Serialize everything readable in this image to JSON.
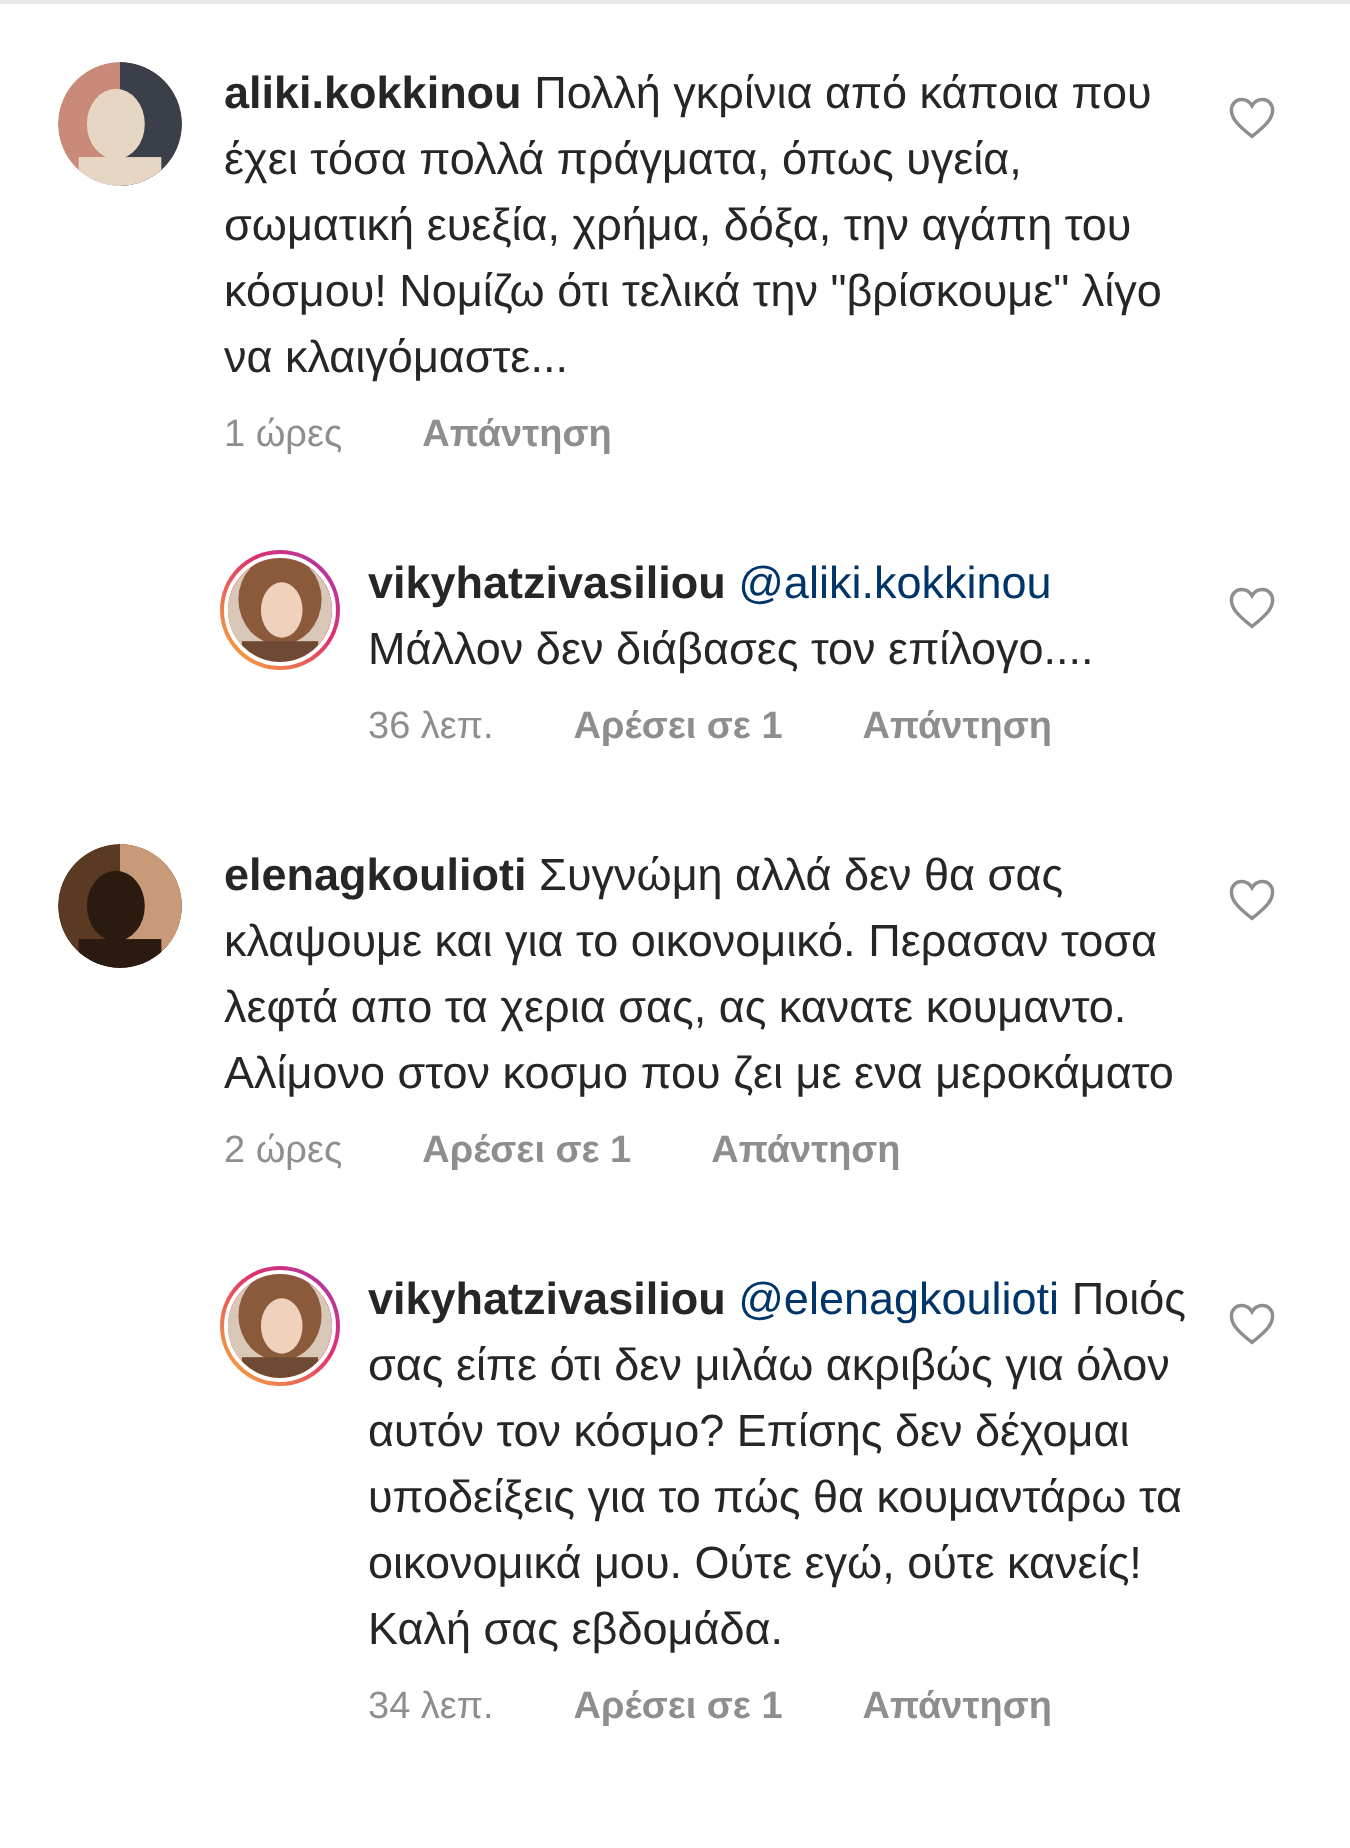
{
  "comments": [
    {
      "username": "aliki.kokkinou",
      "text": "Πολλή γκρίνια από κάποια που έχει τόσα πολλά πράγματα, όπως υγεία, σωματική ευεξία, χρήμα, δόξα, την αγάπη του κόσμου! Νομίζω ότι τελικά την \"βρίσκουμε\" λίγο να κλαιγόμαστε...",
      "time": "1 ώρες",
      "reply_label": "Απάντηση",
      "story_ring": false,
      "replies": [
        {
          "username": "vikyhatzivasiliou",
          "mention": "@aliki.kokkinou",
          "text": "Μάλλον δεν διάβασες τον επίλογο....",
          "time": "36 λεπ.",
          "likes": "Αρέσει σε 1",
          "reply_label": "Απάντηση",
          "story_ring": true
        }
      ]
    },
    {
      "username": "elenagkoulioti",
      "text": "Συγνώμη αλλά δεν θα σας κλαψουμε και για το οικονομικό. Περασαν τοσα λεφτά απο τα χερια σας, ας κανατε κουμαντο. Αλίμονο στον κοσμο που ζει με ενα μεροκάματο",
      "time": "2 ώρες",
      "likes": "Αρέσει σε 1",
      "reply_label": "Απάντηση",
      "story_ring": false,
      "replies": [
        {
          "username": "vikyhatzivasiliou",
          "mention": "@elenagkoulioti",
          "text": "Ποιός σας είπε ότι δεν μιλάω ακριβώς για όλον αυτόν τον κόσμο? Επίσης δεν δέχομαι υποδείξεις για το πώς θα κουμαντάρω τα οικονομικά μου. Ούτε εγώ, ούτε κανείς! Καλή σας εβδομάδα.",
          "time": "34 λεπ.",
          "likes": "Αρέσει σε 1",
          "reply_label": "Απάντηση",
          "story_ring": true
        }
      ]
    }
  ]
}
